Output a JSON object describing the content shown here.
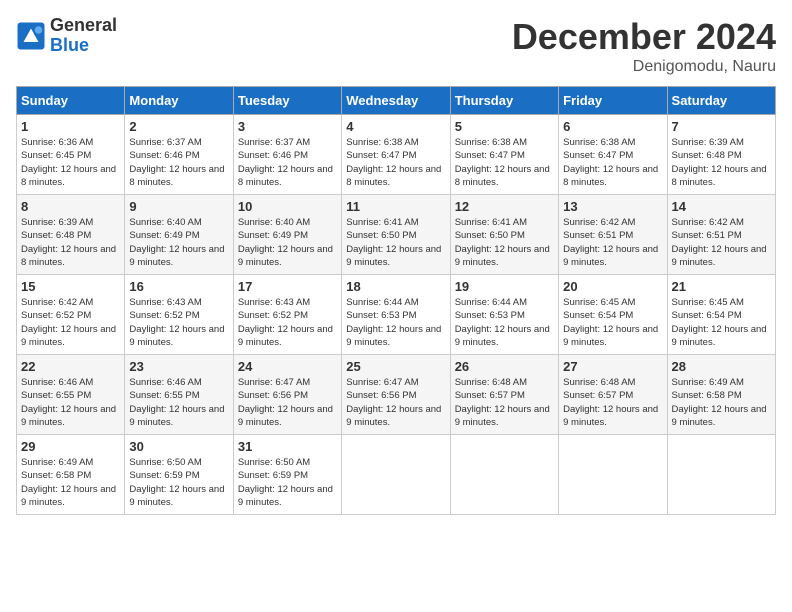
{
  "logo": {
    "general": "General",
    "blue": "Blue"
  },
  "title": "December 2024",
  "location": "Denigomodu, Nauru",
  "days_of_week": [
    "Sunday",
    "Monday",
    "Tuesday",
    "Wednesday",
    "Thursday",
    "Friday",
    "Saturday"
  ],
  "weeks": [
    [
      {
        "day": "1",
        "sunrise": "6:36 AM",
        "sunset": "6:45 PM",
        "daylight": "12 hours and 8 minutes."
      },
      {
        "day": "2",
        "sunrise": "6:37 AM",
        "sunset": "6:46 PM",
        "daylight": "12 hours and 8 minutes."
      },
      {
        "day": "3",
        "sunrise": "6:37 AM",
        "sunset": "6:46 PM",
        "daylight": "12 hours and 8 minutes."
      },
      {
        "day": "4",
        "sunrise": "6:38 AM",
        "sunset": "6:47 PM",
        "daylight": "12 hours and 8 minutes."
      },
      {
        "day": "5",
        "sunrise": "6:38 AM",
        "sunset": "6:47 PM",
        "daylight": "12 hours and 8 minutes."
      },
      {
        "day": "6",
        "sunrise": "6:38 AM",
        "sunset": "6:47 PM",
        "daylight": "12 hours and 8 minutes."
      },
      {
        "day": "7",
        "sunrise": "6:39 AM",
        "sunset": "6:48 PM",
        "daylight": "12 hours and 8 minutes."
      }
    ],
    [
      {
        "day": "8",
        "sunrise": "6:39 AM",
        "sunset": "6:48 PM",
        "daylight": "12 hours and 8 minutes."
      },
      {
        "day": "9",
        "sunrise": "6:40 AM",
        "sunset": "6:49 PM",
        "daylight": "12 hours and 9 minutes."
      },
      {
        "day": "10",
        "sunrise": "6:40 AM",
        "sunset": "6:49 PM",
        "daylight": "12 hours and 9 minutes."
      },
      {
        "day": "11",
        "sunrise": "6:41 AM",
        "sunset": "6:50 PM",
        "daylight": "12 hours and 9 minutes."
      },
      {
        "day": "12",
        "sunrise": "6:41 AM",
        "sunset": "6:50 PM",
        "daylight": "12 hours and 9 minutes."
      },
      {
        "day": "13",
        "sunrise": "6:42 AM",
        "sunset": "6:51 PM",
        "daylight": "12 hours and 9 minutes."
      },
      {
        "day": "14",
        "sunrise": "6:42 AM",
        "sunset": "6:51 PM",
        "daylight": "12 hours and 9 minutes."
      }
    ],
    [
      {
        "day": "15",
        "sunrise": "6:42 AM",
        "sunset": "6:52 PM",
        "daylight": "12 hours and 9 minutes."
      },
      {
        "day": "16",
        "sunrise": "6:43 AM",
        "sunset": "6:52 PM",
        "daylight": "12 hours and 9 minutes."
      },
      {
        "day": "17",
        "sunrise": "6:43 AM",
        "sunset": "6:52 PM",
        "daylight": "12 hours and 9 minutes."
      },
      {
        "day": "18",
        "sunrise": "6:44 AM",
        "sunset": "6:53 PM",
        "daylight": "12 hours and 9 minutes."
      },
      {
        "day": "19",
        "sunrise": "6:44 AM",
        "sunset": "6:53 PM",
        "daylight": "12 hours and 9 minutes."
      },
      {
        "day": "20",
        "sunrise": "6:45 AM",
        "sunset": "6:54 PM",
        "daylight": "12 hours and 9 minutes."
      },
      {
        "day": "21",
        "sunrise": "6:45 AM",
        "sunset": "6:54 PM",
        "daylight": "12 hours and 9 minutes."
      }
    ],
    [
      {
        "day": "22",
        "sunrise": "6:46 AM",
        "sunset": "6:55 PM",
        "daylight": "12 hours and 9 minutes."
      },
      {
        "day": "23",
        "sunrise": "6:46 AM",
        "sunset": "6:55 PM",
        "daylight": "12 hours and 9 minutes."
      },
      {
        "day": "24",
        "sunrise": "6:47 AM",
        "sunset": "6:56 PM",
        "daylight": "12 hours and 9 minutes."
      },
      {
        "day": "25",
        "sunrise": "6:47 AM",
        "sunset": "6:56 PM",
        "daylight": "12 hours and 9 minutes."
      },
      {
        "day": "26",
        "sunrise": "6:48 AM",
        "sunset": "6:57 PM",
        "daylight": "12 hours and 9 minutes."
      },
      {
        "day": "27",
        "sunrise": "6:48 AM",
        "sunset": "6:57 PM",
        "daylight": "12 hours and 9 minutes."
      },
      {
        "day": "28",
        "sunrise": "6:49 AM",
        "sunset": "6:58 PM",
        "daylight": "12 hours and 9 minutes."
      }
    ],
    [
      {
        "day": "29",
        "sunrise": "6:49 AM",
        "sunset": "6:58 PM",
        "daylight": "12 hours and 9 minutes."
      },
      {
        "day": "30",
        "sunrise": "6:50 AM",
        "sunset": "6:59 PM",
        "daylight": "12 hours and 9 minutes."
      },
      {
        "day": "31",
        "sunrise": "6:50 AM",
        "sunset": "6:59 PM",
        "daylight": "12 hours and 9 minutes."
      },
      null,
      null,
      null,
      null
    ]
  ],
  "labels": {
    "sunrise": "Sunrise:",
    "sunset": "Sunset:",
    "daylight": "Daylight:"
  }
}
